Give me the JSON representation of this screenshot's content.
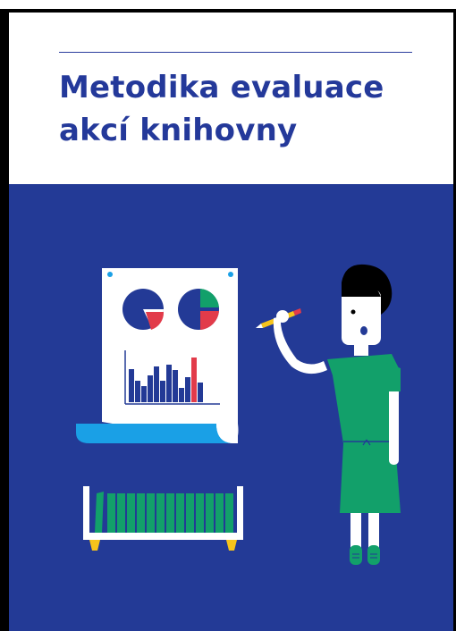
{
  "cover": {
    "title_line1": "Metodika evaluace",
    "title_line2": "akcí knihovny"
  },
  "colors": {
    "title": "#24399a",
    "background_blue": "#233a96",
    "accent_green": "#12a06a",
    "accent_red": "#e23b4a",
    "accent_light_blue": "#1aa0e6",
    "accent_yellow": "#f6c41b"
  },
  "illustration": {
    "subjects": [
      "presentation-board",
      "pie-chart-icon",
      "bar-chart-icon",
      "bookshelf",
      "woman-with-pencil"
    ]
  }
}
